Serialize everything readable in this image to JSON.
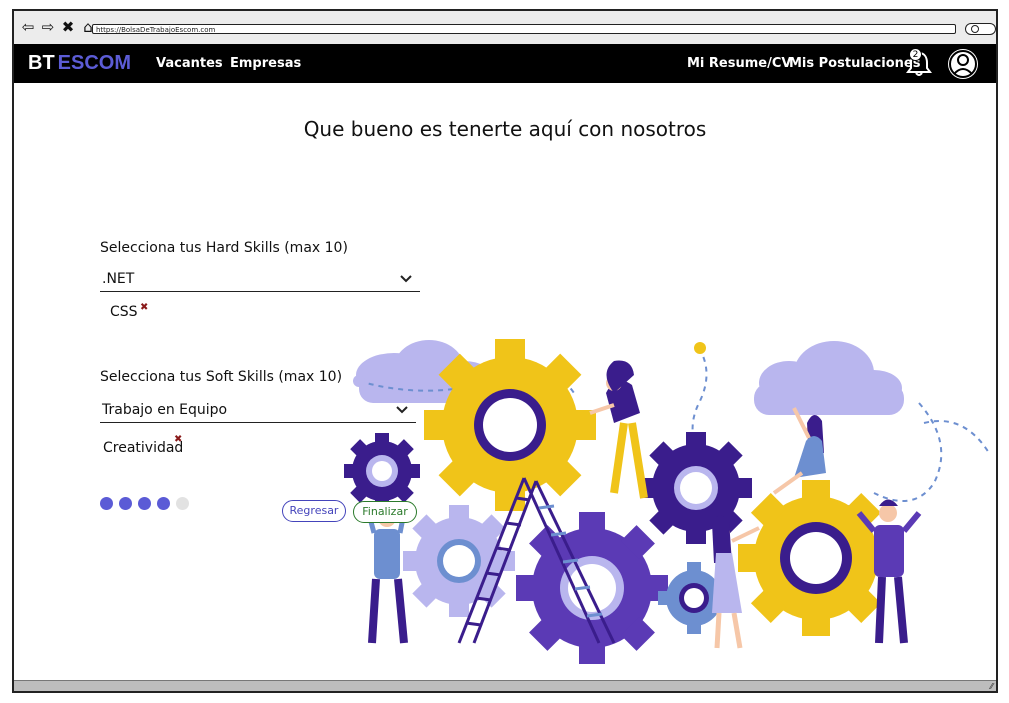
{
  "browser": {
    "url": "https://BolsaDeTrabajoEscom.com",
    "nav_icons": [
      "back-arrow-icon",
      "forward-arrow-icon",
      "close-icon",
      "home-icon"
    ]
  },
  "header": {
    "brand_part1": "BT",
    "brand_part2": "ESCOM",
    "nav": [
      "Vacantes",
      "Empresas"
    ],
    "right_nav": [
      "Mi Resume/CV",
      "Mis Postulaciones"
    ],
    "notification_count": "2",
    "brand_color": "#5c5cd6"
  },
  "main": {
    "headline": "Que bueno es tenerte aquí con nosotros",
    "hard_skills": {
      "label": "Selecciona tus Hard Skills (max 10)",
      "selected": ".NET",
      "chips": [
        "CSS"
      ]
    },
    "soft_skills": {
      "label": "Selecciona tus Soft Skills (max 10)",
      "selected": "Trabajo en Equipo",
      "chips": [
        "Creatividad"
      ]
    },
    "progress": {
      "total_steps": 5,
      "completed_steps": 4
    },
    "buttons": {
      "back": "Regresar",
      "finish": "Finalizar"
    }
  },
  "colors": {
    "accent": "#5b5bd6",
    "gear_yellow": "#f0c419",
    "gear_purple": "#3a1d8c",
    "back_button": "#4444bb",
    "finish_button": "#2b7a2b"
  }
}
